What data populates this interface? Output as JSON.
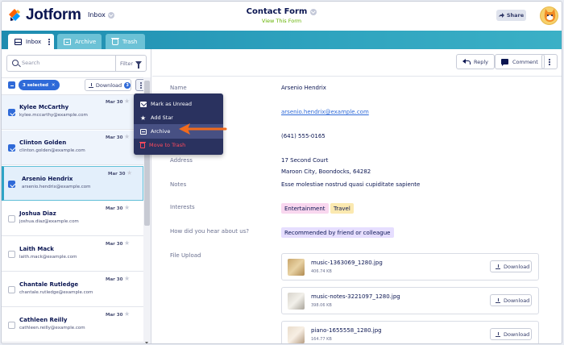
{
  "header": {
    "brand": "Jotform",
    "inbox_switch": "Inbox",
    "form_title": "Contact Form",
    "form_link": "View This Form",
    "share_label": "Share"
  },
  "tabs": [
    {
      "label": "Inbox",
      "active": true
    },
    {
      "label": "Archive",
      "active": false
    },
    {
      "label": "Trash",
      "active": false
    }
  ],
  "search": {
    "placeholder": "Search",
    "filter_label": "Filter"
  },
  "selection": {
    "pill": "3 selected",
    "download_label": "Download",
    "download_count": "3"
  },
  "submissions": [
    {
      "name": "Kylee McCarthy",
      "email": "kylee.mccarthy@example.com",
      "date": "Mar 30",
      "checked": true
    },
    {
      "name": "Clinton Golden",
      "email": "clinton.golden@example.com",
      "date": "Mar 30",
      "checked": true
    },
    {
      "name": "Arsenio Hendrix",
      "email": "arsenio.hendrix@example.com",
      "date": "Mar 30",
      "checked": true
    },
    {
      "name": "Joshua Diaz",
      "email": "joshua.diaz@example.com",
      "date": "Mar 30",
      "checked": false
    },
    {
      "name": "Laith Mack",
      "email": "laith.mack@example.com",
      "date": "Mar 30",
      "checked": false
    },
    {
      "name": "Chantale Rutledge",
      "email": "chantale.rutledge@example.com",
      "date": "Mar 30",
      "checked": false
    },
    {
      "name": "Cathleen Reilly",
      "email": "cathleen.reilly@example.com",
      "date": "Mar 30",
      "checked": false
    }
  ],
  "bulk_menu": {
    "mark_unread": "Mark as Unread",
    "add_star": "Add Star",
    "archive": "Archive",
    "move_trash": "Move to Trash"
  },
  "toolbar": {
    "reply_label": "Reply",
    "comment_label": "Comment"
  },
  "detail": {
    "name_label": "Name",
    "name_value": "Arsenio Hendrix",
    "email_value": "arsenio.hendrix@example.com",
    "phone_value": "(641) 555-0165",
    "address_label": "Address",
    "address_line1": "17 Second Court",
    "address_line2": "Maroon City, Boondocks, 64282",
    "notes_label": "Notes",
    "notes_value": "Esse molestiae nostrud quasi cupiditate sapiente",
    "interests_label": "Interests",
    "interests": [
      "Entertainment",
      "Travel"
    ],
    "hear_label": "How did you hear about us?",
    "hear_value": "Recommended by friend or colleague",
    "upload_label": "File Upload",
    "files": [
      {
        "name": "music-1363069_1280.jpg",
        "size": "406.74 KB",
        "action": "Download"
      },
      {
        "name": "music-notes-3221097_1280.jpg",
        "size": "398.06 KB",
        "action": "Download"
      },
      {
        "name": "piano-1655558_1280.jpg",
        "size": "164.77 KB",
        "action": "Download"
      }
    ]
  },
  "colors": {
    "accent": "#2f6ad8",
    "tabbar": "#2fa4bf",
    "menu_bg": "#2a325f",
    "danger": "#ff4a5c",
    "tag_pink": "#f9d7ef",
    "tag_yellow": "#fbe9b0",
    "tag_purple": "#e6deff"
  }
}
